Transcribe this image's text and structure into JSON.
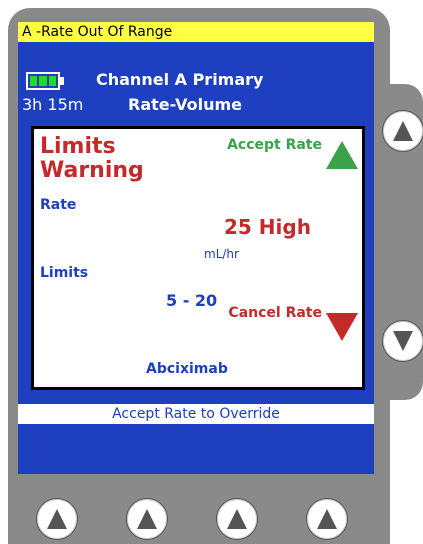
{
  "screen": {
    "alarm_bar": "A -Rate Out Of Range",
    "channel_title": "Channel A Primary",
    "time_remaining": "3h 15m",
    "mode": "Rate-Volume",
    "warning": {
      "title": "Limits Warning",
      "rate_label": "Rate",
      "rate_value": "25 High",
      "rate_unit": "mL/hr",
      "limits_label": "Limits",
      "limits_range": "5 - 20",
      "drug": "Abciximab",
      "accept_label": "Accept Rate",
      "cancel_label": "Cancel Rate"
    },
    "override_bar": "Accept Rate to Override"
  },
  "colors": {
    "screen_bg": "#1d3fc0",
    "alarm_bar_bg": "#ffff44",
    "warning_red": "#c42a2a",
    "accept_green": "#3aa24a",
    "battery_green": "#22dd22"
  },
  "icons": {
    "battery": "battery-icon",
    "accept": "triangle-up-icon",
    "cancel": "triangle-down-icon",
    "softkeys": "arrow-up-icon"
  }
}
